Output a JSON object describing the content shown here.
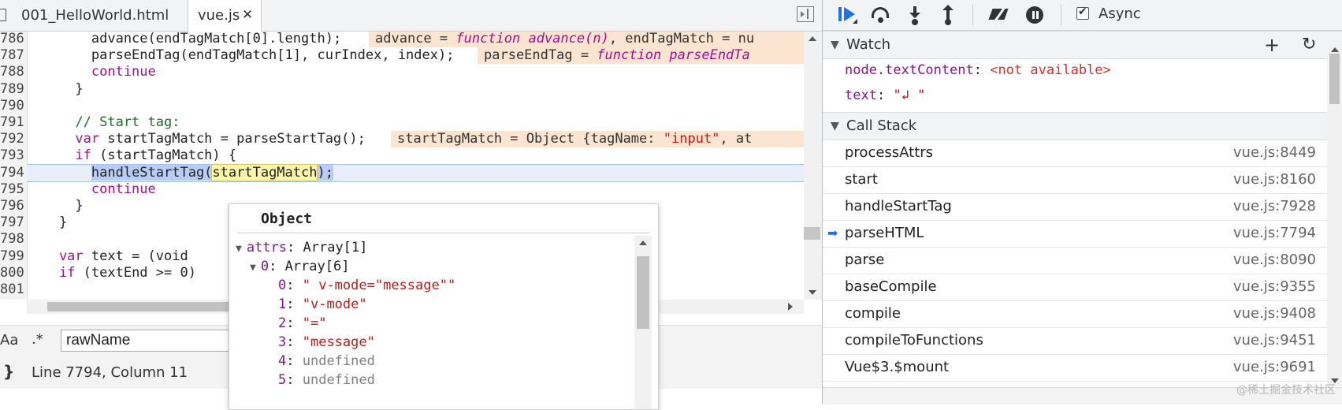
{
  "tabs": [
    {
      "label": "001_HelloWorld.html",
      "active": false
    },
    {
      "label": "vue.js",
      "active": true,
      "close": "✕"
    }
  ],
  "editor": {
    "lines": [
      {
        "num": "786",
        "parts": [
          [
            "",
            "        advance(endTagMatch["
          ],
          [
            "num",
            "0"
          ],
          [
            "",
            "].length);"
          ]
        ]
      },
      {
        "num": "787",
        "parts": [
          [
            "",
            "        parseEndTag(endTagMatch["
          ],
          [
            "num",
            "1"
          ],
          [
            "",
            "], curIndex, index);"
          ]
        ]
      },
      {
        "num": "788",
        "parts": [
          [
            "kw",
            "        continue"
          ]
        ]
      },
      {
        "num": "789",
        "parts": [
          [
            "",
            "      }"
          ]
        ]
      },
      {
        "num": "790",
        "parts": [
          [
            "",
            ""
          ]
        ]
      },
      {
        "num": "791",
        "parts": [
          [
            "cm",
            "      // Start tag:"
          ]
        ]
      },
      {
        "num": "792",
        "parts": [
          [
            "kw",
            "      var"
          ],
          [
            "",
            " startTagMatch = parseStartTag();"
          ]
        ]
      },
      {
        "num": "793",
        "parts": [
          [
            "kw",
            "      if"
          ],
          [
            "",
            " (startTagMatch) {"
          ]
        ]
      },
      {
        "num": "794",
        "parts": [
          [
            "",
            "        "
          ],
          [
            "sel",
            "handleStartTag("
          ],
          [
            "yel",
            "startTagMatch"
          ],
          [
            "sel",
            ");"
          ]
        ]
      },
      {
        "num": "795",
        "parts": [
          [
            "kw",
            "        continue"
          ]
        ]
      },
      {
        "num": "796",
        "parts": [
          [
            "",
            "      }"
          ]
        ]
      },
      {
        "num": "797",
        "parts": [
          [
            "",
            "    }"
          ]
        ]
      },
      {
        "num": "798",
        "parts": [
          [
            "",
            ""
          ]
        ]
      },
      {
        "num": "799",
        "parts": [
          [
            "kw",
            "    var"
          ],
          [
            "",
            " text = (void"
          ]
        ]
      },
      {
        "num": "800",
        "parts": [
          [
            "kw",
            "    if"
          ],
          [
            "",
            " (textEnd >= "
          ],
          [
            "num",
            "0"
          ],
          [
            "",
            ")"
          ]
        ]
      },
      {
        "num": "801",
        "parts": [
          [
            "",
            ""
          ]
        ]
      }
    ],
    "inline_values": [
      {
        "line": 0,
        "parts": [
          [
            "",
            "advance = "
          ],
          [
            "i",
            "function advance(n)"
          ],
          [
            "",
            ", endTagMatch = nu"
          ]
        ]
      },
      {
        "line": 1,
        "parts": [
          [
            "",
            "parseEndTag = "
          ],
          [
            "i",
            "function parseEndTa"
          ]
        ]
      },
      {
        "line": 6,
        "parts": [
          [
            "",
            "startTagMatch = Object {tagName: "
          ],
          [
            "str",
            "\"input\""
          ],
          [
            "",
            ", at"
          ]
        ]
      }
    ]
  },
  "search": {
    "case_label": "Aa",
    "regex_label": ".*",
    "value": "rawName"
  },
  "status": {
    "brace": "}",
    "text": "Line 7794, Column 11"
  },
  "popover": {
    "title": "Object",
    "rows": [
      {
        "indent": 0,
        "tri": "▼",
        "key": "attrs",
        "val": "Array[1]",
        "type": "obj"
      },
      {
        "indent": 1,
        "tri": "▼",
        "key": "0",
        "val": "Array[6]",
        "type": "obj"
      },
      {
        "indent": 2,
        "tri": "",
        "key": "0",
        "val": "\" v-mode=\"message\"\"",
        "type": "str"
      },
      {
        "indent": 2,
        "tri": "",
        "key": "1",
        "val": "\"v-mode\"",
        "type": "str"
      },
      {
        "indent": 2,
        "tri": "",
        "key": "2",
        "val": "\"=\"",
        "type": "str"
      },
      {
        "indent": 2,
        "tri": "",
        "key": "3",
        "val": "\"message\"",
        "type": "str"
      },
      {
        "indent": 2,
        "tri": "",
        "key": "4",
        "val": "undefined",
        "type": "undef"
      },
      {
        "indent": 2,
        "tri": "",
        "key": "5",
        "val": "undefined",
        "type": "undef"
      }
    ]
  },
  "debugger": {
    "async_label": "Async",
    "async_checked": true,
    "watch": {
      "title": "Watch",
      "add": "+",
      "refresh": "↻",
      "items": [
        {
          "key": "node.textContent",
          "sep": ": ",
          "val": "<not available>",
          "type": "na"
        },
        {
          "key": "text",
          "sep": ": ",
          "val": "\"↲ \"",
          "type": "str"
        }
      ]
    },
    "call_stack": {
      "title": "Call Stack",
      "frames": [
        {
          "fn": "processAttrs",
          "loc": "vue.js:8449",
          "current": false
        },
        {
          "fn": "start",
          "loc": "vue.js:8160",
          "current": false
        },
        {
          "fn": "handleStartTag",
          "loc": "vue.js:7928",
          "current": false
        },
        {
          "fn": "parseHTML",
          "loc": "vue.js:7794",
          "current": true
        },
        {
          "fn": "parse",
          "loc": "vue.js:8090",
          "current": false
        },
        {
          "fn": "baseCompile",
          "loc": "vue.js:9355",
          "current": false
        },
        {
          "fn": "compile",
          "loc": "vue.js:9408",
          "current": false
        },
        {
          "fn": "compileToFunctions",
          "loc": "vue.js:9451",
          "current": false
        },
        {
          "fn": "Vue$3.$mount",
          "loc": "vue.js:9691",
          "current": false
        }
      ]
    }
  },
  "watermark": "@稀土掘金技术社区",
  "colors": {
    "accent": "#1a73e8",
    "keyword": "#aa0d91",
    "comment": "#236e25",
    "string": "#c41a16",
    "property": "#881391"
  }
}
